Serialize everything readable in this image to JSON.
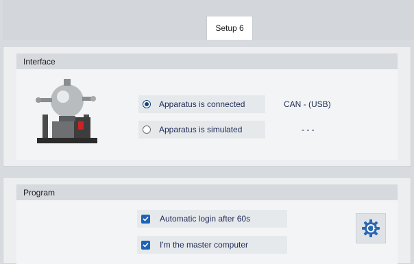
{
  "tabs": [
    {
      "label": "Setup 6",
      "active": true
    }
  ],
  "interface": {
    "title": "Interface",
    "options": [
      {
        "label": "Apparatus is connected",
        "selected": true,
        "value": "CAN  - (USB)"
      },
      {
        "label": "Apparatus is simulated",
        "selected": false,
        "value": "- - -"
      }
    ]
  },
  "program": {
    "title": "Program",
    "checks": [
      {
        "label": "Automatic login after 60s",
        "checked": true
      },
      {
        "label": "I'm the master computer",
        "checked": true
      }
    ],
    "settings_icon": "gear-refresh-icon"
  },
  "colors": {
    "accent": "#1b63b8",
    "text": "#1e2a55",
    "radio": "#10457f"
  }
}
